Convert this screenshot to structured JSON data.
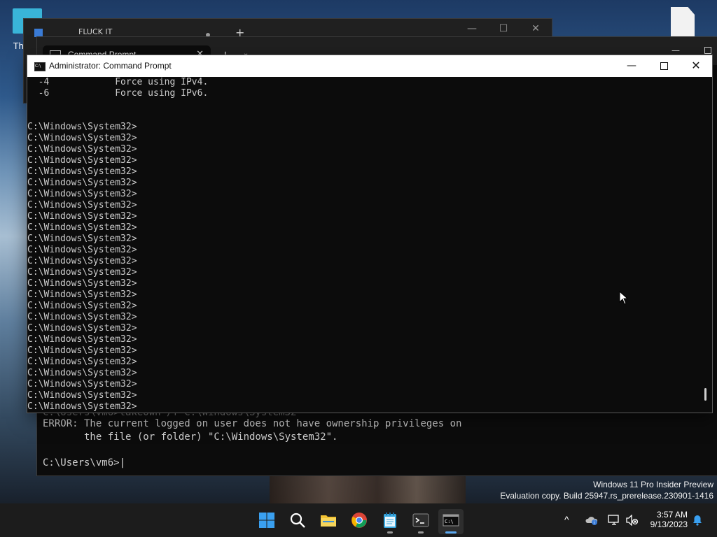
{
  "desktop": {
    "icon_label": "Th",
    "watermark_line1": "Windows 11 Pro Insider Preview",
    "watermark_line2": "Evaluation copy. Build 25947.rs_prerelease.230901-1416"
  },
  "back_window": {
    "tab_title": "FLUCK IT",
    "new_tab_label": "+"
  },
  "terminal_window": {
    "tab_title": "Command Prompt",
    "close_label": "✕",
    "new_tab_label": "+",
    "dropdown_label": "⌄",
    "lines": {
      "l0": "C:\\Users\\vm6>takeown /f C:\\Windows\\System32",
      "l1": "ERROR: The current logged on user does not have ownership privileges on",
      "l2": "       the file (or folder) \"C:\\Windows\\System32\".",
      "prompt": "C:\\Users\\vm6>"
    }
  },
  "cmd_window": {
    "title": "Administrator: Command Prompt",
    "minimize_label": "—",
    "close_label": "✕",
    "output": {
      "l0": "  -4            Force using IPv4.",
      "l1": "  -6            Force using IPv6.",
      "l2": "",
      "l3": "",
      "prompt": "C:\\Windows\\System32>"
    },
    "prompt_line_count": 26
  },
  "taskbar": {
    "icons": [
      "start-icon",
      "search-icon",
      "file-explorer-icon",
      "chrome-icon",
      "notepad-icon",
      "terminal-icon",
      "command-prompt-icon"
    ],
    "tray": {
      "chevron": "^",
      "time": "3:57 AM",
      "date": "9/13/2023"
    }
  },
  "colors": {
    "console_bg": "#0c0c0c",
    "console_text": "#cccccc",
    "taskbar_bg": "#1c1c1c",
    "titlebar_bg": "#ffffff"
  }
}
